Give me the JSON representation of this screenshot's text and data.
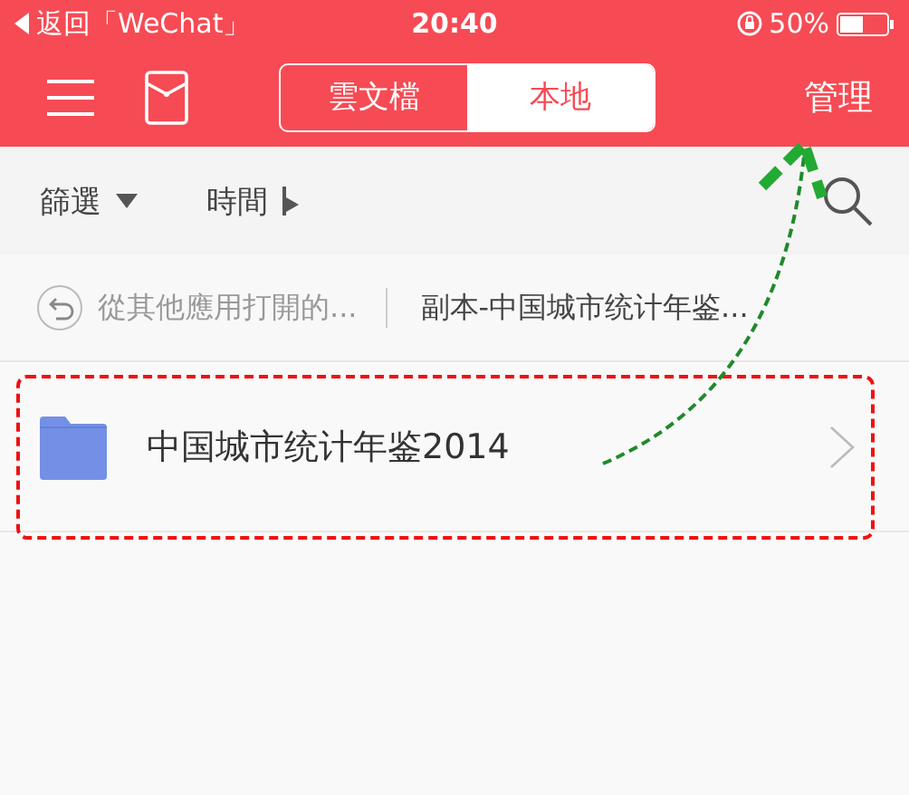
{
  "status_bar": {
    "back_label": "返回「WeChat」",
    "time": "20:40",
    "battery": "50%"
  },
  "nav": {
    "tabs": [
      {
        "label": "雲文檔",
        "selected": false
      },
      {
        "label": "本地",
        "selected": true
      }
    ],
    "action": "管理"
  },
  "filters": [
    {
      "label": "篩選",
      "kind": "dropdown"
    },
    {
      "label": "時間",
      "kind": "sort"
    }
  ],
  "breadcrumbs": [
    "從其他應用打開的...",
    "副本-中国城市统计年鉴..."
  ],
  "files": [
    {
      "name": "中国城市统计年鉴2014",
      "kind": "folder"
    }
  ]
}
